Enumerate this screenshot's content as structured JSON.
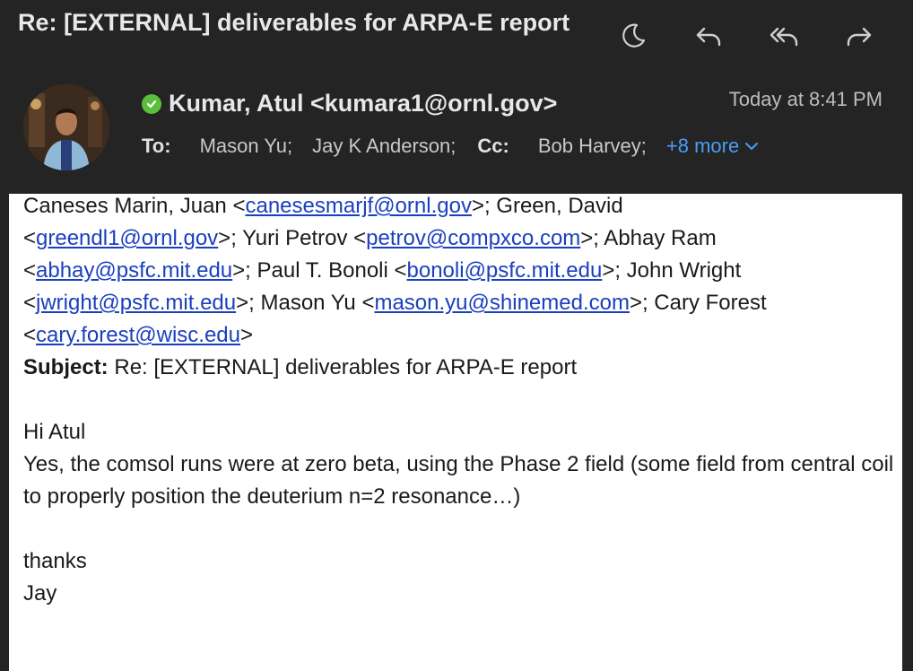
{
  "window": {
    "subject": "Re: [EXTERNAL] deliverables for ARPA-E report"
  },
  "toolbar": {
    "icons": [
      "moon-icon",
      "reply-icon",
      "reply-all-icon",
      "forward-icon"
    ]
  },
  "message": {
    "sender": "Kumar, Atul <kumara1@ornl.gov>",
    "date": "Today at 8:41 PM",
    "to_label": "To:",
    "to": [
      "Mason Yu;",
      "Jay K Anderson;"
    ],
    "cc_label": "Cc:",
    "cc": [
      "Bob Harvey;"
    ],
    "more": "+8 more"
  },
  "quoted": {
    "line1_prefix": "Caneses Marin, Juan <",
    "line1_email": "canesesmarjf@ornl.gov",
    "line1_suffix": ">; Green, David",
    "line2_prefix": "<",
    "line2_email": "greendl1@ornl.gov",
    "line2_mid": ">; Yuri Petrov <",
    "line2_email2": "petrov@compxco.com",
    "line2_suffix": ">; Abhay Ram",
    "line3_prefix": "<",
    "line3_email": "abhay@psfc.mit.edu",
    "line3_mid": ">; Paul T. Bonoli <",
    "line3_email2": "bonoli@psfc.mit.edu",
    "line3_suffix": ">; John Wright",
    "line4_prefix": "<",
    "line4_email": "jwright@psfc.mit.edu",
    "line4_mid": ">; Mason Yu <",
    "line4_email2": "mason.yu@shinemed.com",
    "line4_suffix": ">; Cary Forest",
    "line5_prefix": "<",
    "line5_email": "cary.forest@wisc.edu",
    "line5_suffix": ">",
    "subject_label": "Subject:",
    "subject_value": " Re: [EXTERNAL] deliverables for ARPA-E report"
  },
  "body": {
    "greeting": "Hi Atul",
    "paragraph": "Yes, the comsol runs were at zero beta, using the Phase 2 field (some field from central coil to properly position the deuterium n=2 resonance…)",
    "signoff": "thanks",
    "signature": "Jay"
  }
}
